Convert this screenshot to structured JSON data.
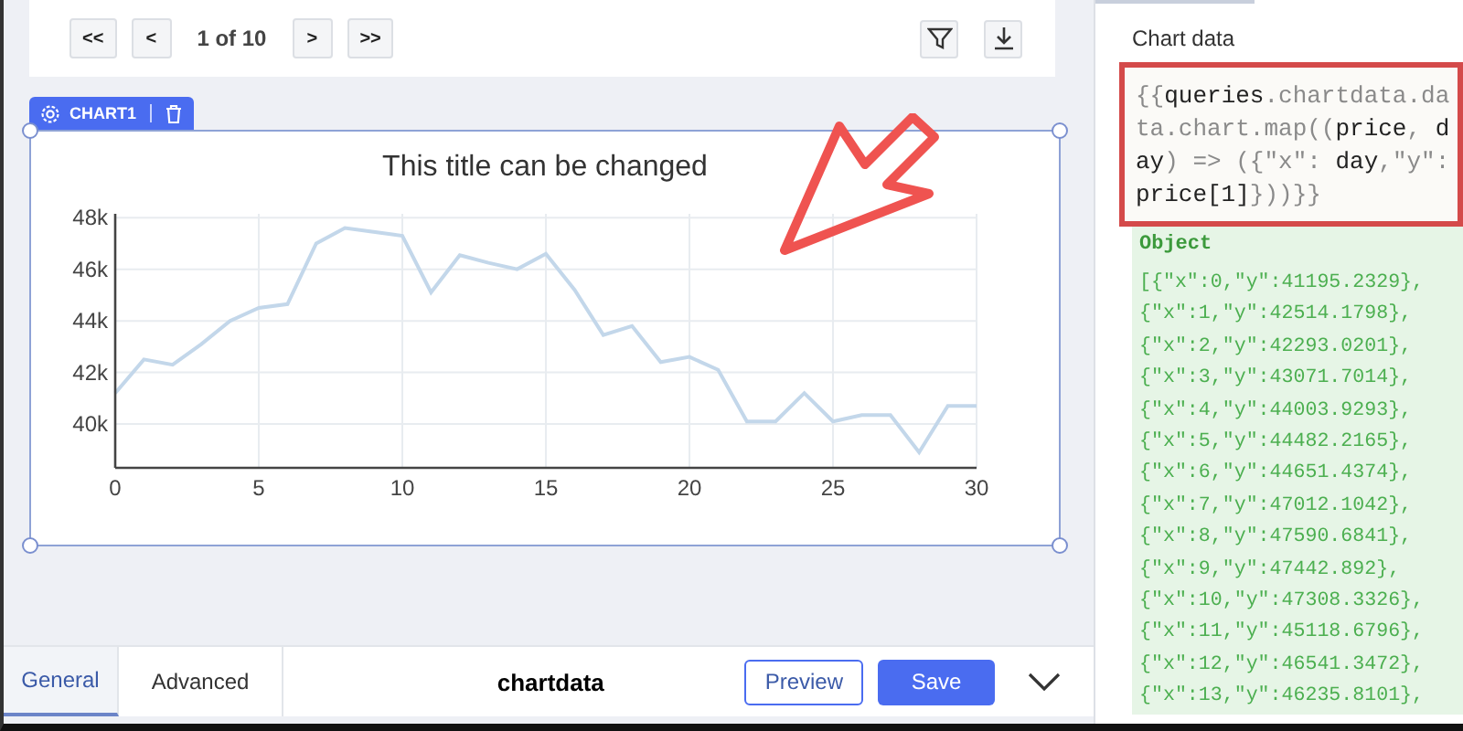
{
  "pagination": {
    "first": "<<",
    "prev": "<",
    "page": "1 of 10",
    "next": ">",
    "last": ">>"
  },
  "widget": {
    "name": "CHART1",
    "chart_data": {
      "type": "line",
      "title": "This title can be changed",
      "x": [
        0,
        1,
        2,
        3,
        4,
        5,
        6,
        7,
        8,
        9,
        10,
        11,
        12,
        13,
        14,
        15,
        16,
        17,
        18,
        19,
        20,
        21,
        22,
        23,
        24,
        25,
        26,
        27,
        28,
        29,
        30
      ],
      "grid": true,
      "series": [
        {
          "color": "#c3d7ea",
          "values": [
            41200,
            42500,
            42300,
            43100,
            44000,
            44500,
            44650,
            47000,
            47600,
            47450,
            47300,
            45100,
            46550,
            46250,
            46000,
            46600,
            45200,
            43450,
            43800,
            42400,
            42600,
            42100,
            40100,
            40100,
            41200,
            40100,
            40350,
            40350,
            38900,
            40700,
            40700
          ]
        }
      ],
      "xlim": [
        0,
        30
      ],
      "ylim": [
        38300,
        48150
      ],
      "xticks": [
        0,
        5,
        10,
        15,
        20,
        25,
        30
      ],
      "yticks": [
        {
          "value": 40000,
          "label": "40k"
        },
        {
          "value": 42000,
          "label": "42k"
        },
        {
          "value": 44000,
          "label": "44k"
        },
        {
          "value": 46000,
          "label": "46k"
        },
        {
          "value": 48000,
          "label": "48k"
        }
      ]
    }
  },
  "editor": {
    "tabs": [
      {
        "label": "General",
        "selected": true
      },
      {
        "label": "Advanced",
        "selected": false
      }
    ],
    "query_name": "chartdata",
    "preview": "Preview",
    "save": "Save"
  },
  "panel": {
    "title": "Chart data",
    "code": "{{**queries**.chartdata.data.chart.map((**price**, **day**) => ({\"x\": **day**,\"y\": **price[1]**}))}}",
    "result_type": "Object",
    "result_lines": [
      "[{\"x\":0,\"y\":41195.2329},",
      "{\"x\":1,\"y\":42514.1798},",
      "{\"x\":2,\"y\":42293.0201},",
      "{\"x\":3,\"y\":43071.7014},",
      "{\"x\":4,\"y\":44003.9293},",
      "{\"x\":5,\"y\":44482.2165},",
      "{\"x\":6,\"y\":44651.4374},",
      "{\"x\":7,\"y\":47012.1042},",
      "{\"x\":8,\"y\":47590.6841},",
      "{\"x\":9,\"y\":47442.892},",
      "{\"x\":10,\"y\":47308.3326},",
      "{\"x\":11,\"y\":45118.6796},",
      "{\"x\":12,\"y\":46541.3472},",
      "{\"x\":13,\"y\":46235.8101},"
    ]
  }
}
